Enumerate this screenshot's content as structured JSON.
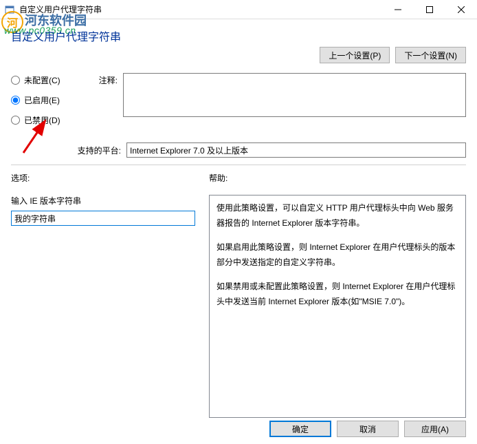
{
  "window": {
    "title": "自定义用户代理字符串",
    "subtitle": "自定义用户代理字符串"
  },
  "nav": {
    "prev": "上一个设置(P)",
    "next": "下一个设置(N)"
  },
  "radios": {
    "not_configured": "未配置(C)",
    "enabled": "已启用(E)",
    "disabled": "已禁用(D)"
  },
  "labels": {
    "comment": "注释:",
    "platform": "支持的平台:",
    "options": "选项:",
    "help": "帮助:",
    "ie_string": "输入 IE 版本字符串"
  },
  "values": {
    "platform": "Internet Explorer 7.0 及以上版本",
    "ie_input": "我的字符串"
  },
  "help": {
    "p1": "使用此策略设置，可以自定义 HTTP 用户代理标头中向 Web 服务器报告的 Internet Explorer 版本字符串。",
    "p2": "如果启用此策略设置，则 Internet Explorer 在用户代理标头的版本部分中发送指定的自定义字符串。",
    "p3": "如果禁用或未配置此策略设置，则 Internet Explorer 在用户代理标头中发送当前 Internet Explorer 版本(如\"MSIE 7.0\")。"
  },
  "footer": {
    "ok": "确定",
    "cancel": "取消",
    "apply": "应用(A)"
  },
  "watermark": {
    "brand": "河东软件园",
    "url": "www.pc0359.cn"
  }
}
